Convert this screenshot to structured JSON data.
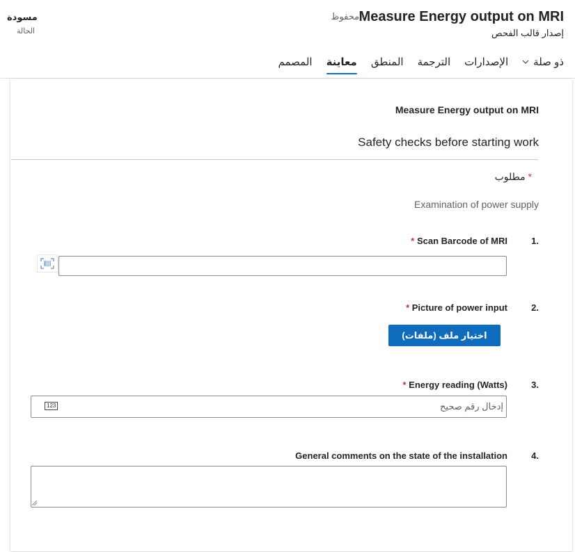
{
  "header": {
    "title": "Measure Energy output on MRI",
    "saved_status": "- محفوظ",
    "subtitle": "إصدار قالب الفحص",
    "status_value": "مسودة",
    "status_label": "الحالة"
  },
  "tabs": [
    {
      "label": "المصمم",
      "active": false
    },
    {
      "label": "معاينة",
      "active": true
    },
    {
      "label": "المنطق",
      "active": false
    },
    {
      "label": "الترجمة",
      "active": false
    },
    {
      "label": "الإصدارات",
      "active": false
    },
    {
      "label": "ذو صلة",
      "active": false
    }
  ],
  "form": {
    "title": "Measure Energy output on MRI",
    "section_title": "Safety checks before starting work",
    "required_note": "مطلوب",
    "required_star": "*",
    "description": "Examination of power supply",
    "questions": [
      {
        "number": "1.",
        "label": "Scan Barcode of MRI",
        "required": "*"
      },
      {
        "number": "2.",
        "label": "Picture of power input",
        "required": "*",
        "button_label": "اختيار ملف (ملفات)"
      },
      {
        "number": "3.",
        "label": "Energy reading (Watts)",
        "required": "*",
        "placeholder": "إدخال رقم صحيح",
        "badge": "123"
      },
      {
        "number": "4.",
        "label": "General comments on the state of the installation"
      }
    ]
  },
  "colors": {
    "accent": "#0f6cbd",
    "required": "#c4314b"
  },
  "icons": [
    "chevron-down-icon",
    "barcode-icon",
    "number-icon",
    "resize-grip-icon"
  ]
}
